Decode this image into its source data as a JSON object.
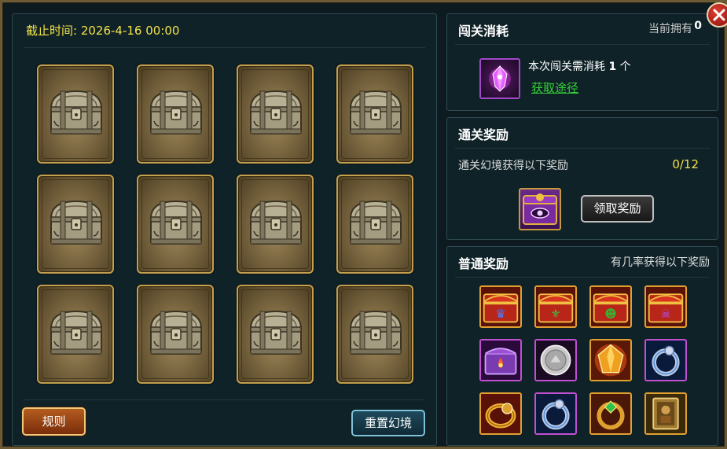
{
  "left": {
    "deadline": "截止时间: 2026-4-16 00:00",
    "chest_count": 12,
    "rules_label": "规则",
    "reset_label": "重置幻境"
  },
  "cost": {
    "title": "闯关消耗",
    "owned_label": "当前拥有",
    "owned_value": "0",
    "cost_prefix": "本次闯关需消耗",
    "cost_count": "1",
    "cost_suffix": "个",
    "obtain_link": "获取途径",
    "item_icon": "purple-crystal-icon"
  },
  "clear": {
    "title": "通关奖励",
    "desc": "通关幻境获得以下奖励",
    "progress": "0/12",
    "reward_icon": "purple-eye-chest-icon",
    "claim_label": "领取奖励"
  },
  "normal": {
    "title": "普通奖励",
    "desc": "有几率获得以下奖励",
    "items": [
      "red-chest-crown-icon",
      "red-chest-fleur-icon",
      "red-chest-demon-icon",
      "red-chest-skull-icon",
      "purple-fire-chest-icon",
      "silver-coin-icon",
      "gold-gem-icon",
      "silver-ring-icon",
      "gold-ring-icon",
      "silver-ring-icon",
      "emerald-gold-ring-icon",
      "card-book-icon"
    ]
  },
  "colors": {
    "deadline": "#f3e24a",
    "progress": "#f3e24a",
    "link": "#35d335",
    "card_border": "#c4a04e"
  }
}
